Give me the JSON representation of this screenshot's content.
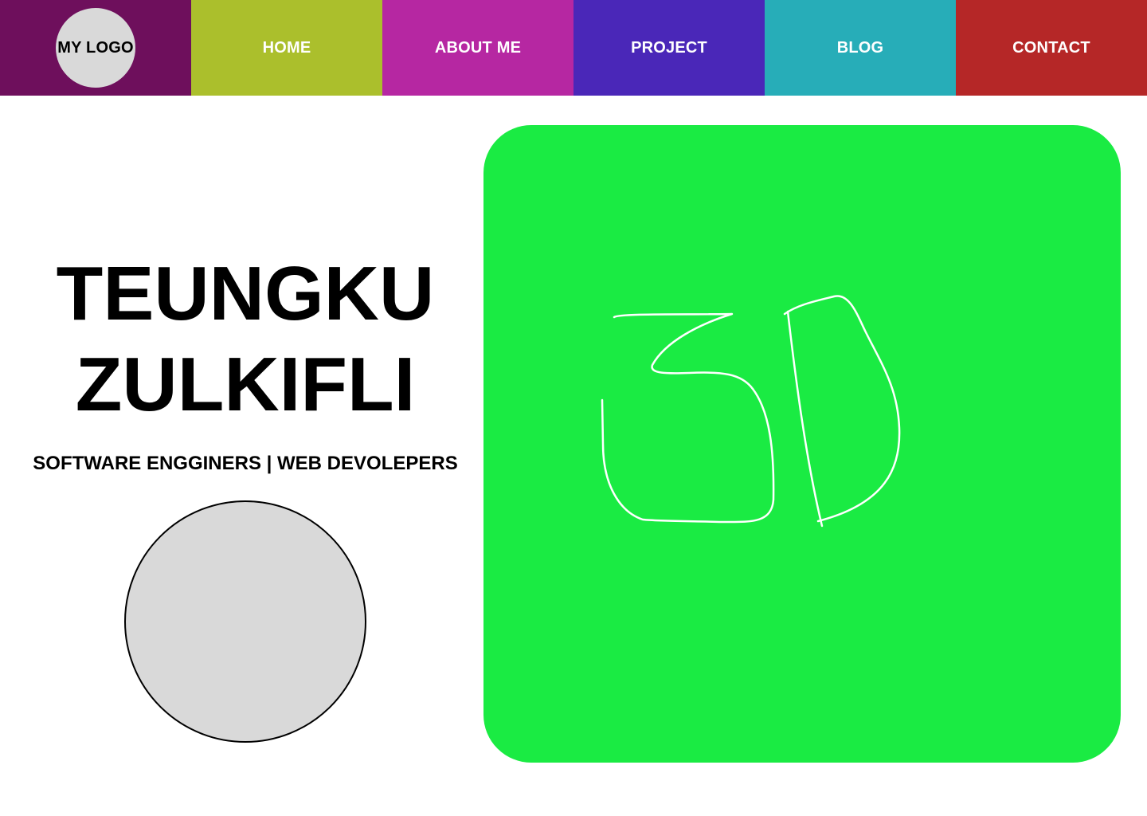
{
  "nav": {
    "logo_text": "MY LOGO",
    "items": [
      {
        "label": "HOME",
        "color": "#abbf2c"
      },
      {
        "label": "ABOUT ME",
        "color": "#b627a2"
      },
      {
        "label": "PROJECT",
        "color": "#4a27b8"
      },
      {
        "label": "BLOG",
        "color": "#27adb8"
      },
      {
        "label": "CONTACT",
        "color": "#b52727"
      }
    ],
    "logo_bg_color": "#6e0f5c"
  },
  "hero": {
    "name_line1": "TEUNGKU",
    "name_line2": "ZULKIFLI",
    "tagline": "SOFTWARE ENGGINERS | WEB DEVOLEPERS"
  },
  "panel": {
    "bg_color": "#1aeb43",
    "sketch_text": "3D"
  }
}
